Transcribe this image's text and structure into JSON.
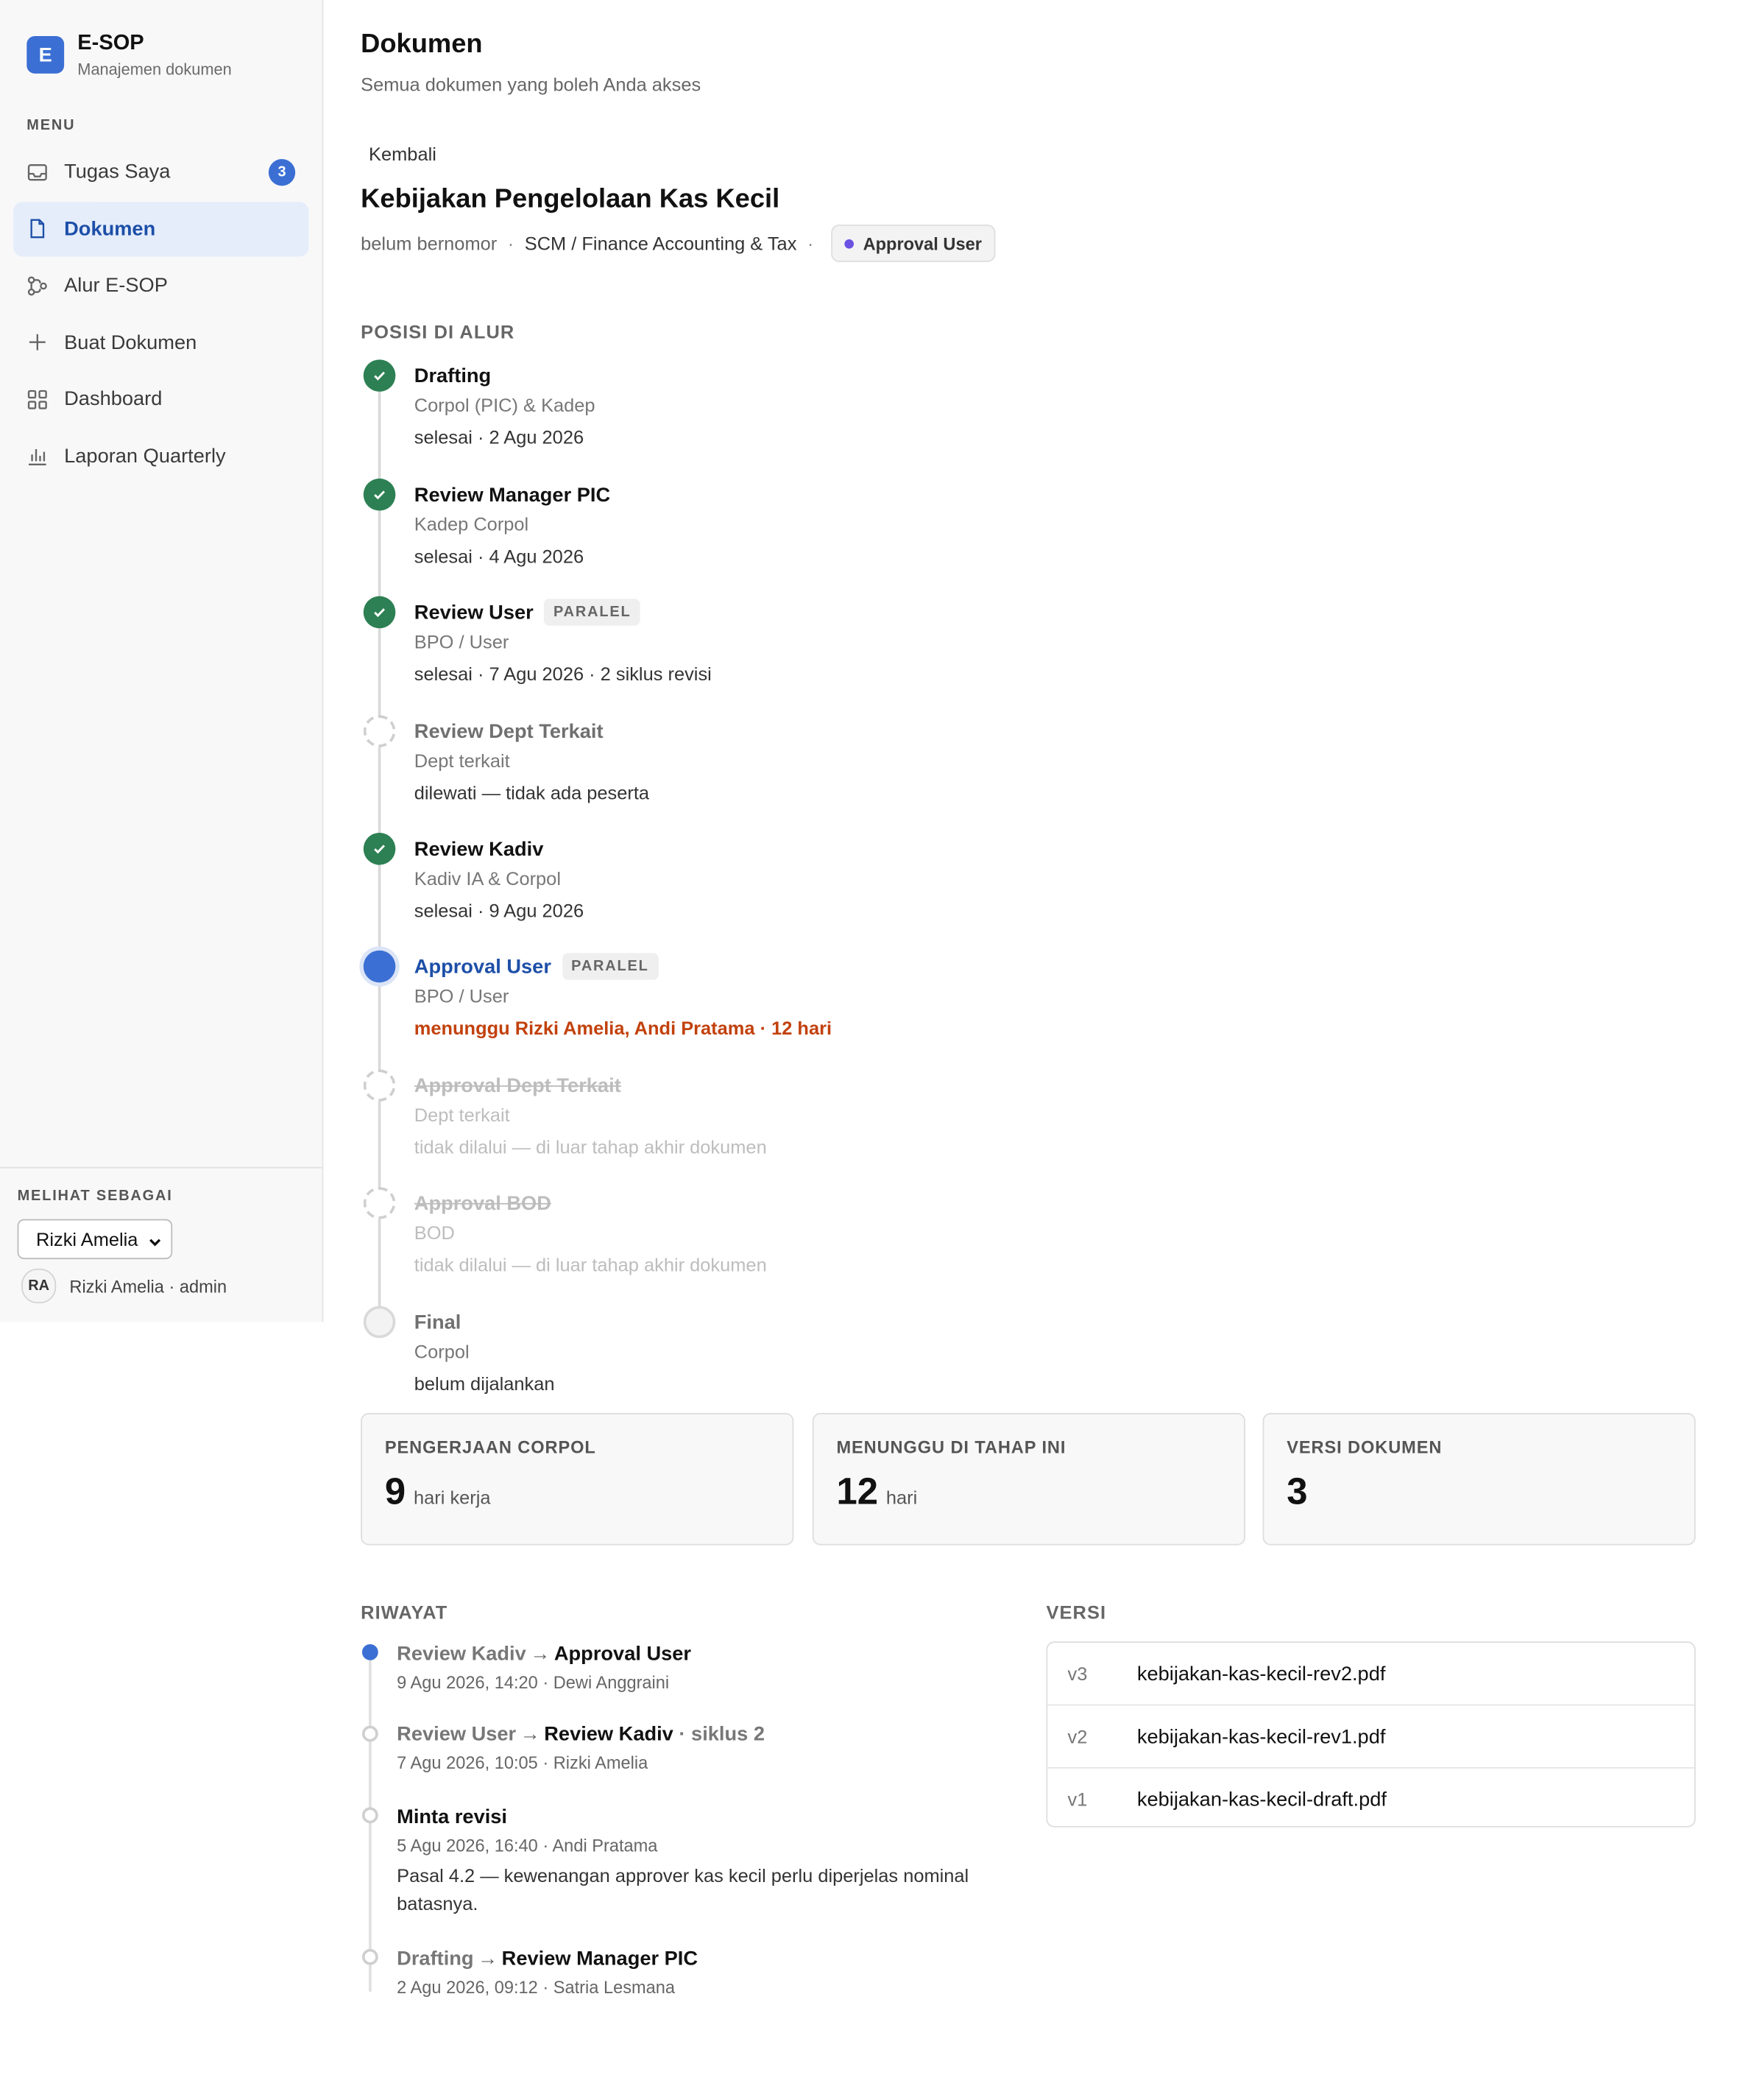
{
  "app": {
    "logo_letter": "E",
    "name": "E-SOP",
    "subtitle": "Manajemen dokumen"
  },
  "sidebar": {
    "menu_label": "MENU",
    "items": [
      {
        "label": "Tugas Saya",
        "icon": "inbox-icon",
        "badge": "3"
      },
      {
        "label": "Dokumen",
        "icon": "document-icon",
        "active": true
      },
      {
        "label": "Alur E-SOP",
        "icon": "workflow-icon"
      },
      {
        "label": "Buat Dokumen",
        "icon": "plus-icon"
      },
      {
        "label": "Dashboard",
        "icon": "grid-icon"
      },
      {
        "label": "Laporan Quarterly",
        "icon": "bar-chart-icon"
      }
    ],
    "view_as_label": "MELIHAT SEBAGAI",
    "view_as_selected": "Rizki Amelia",
    "user_initials": "RA",
    "user_text": "Rizki Amelia · admin"
  },
  "header": {
    "title": "Dokumen",
    "subtitle": "Semua dokumen yang boleh Anda akses"
  },
  "doc": {
    "back_label": "Kembali",
    "title": "Kebijakan Pengelolaan Kas Kecil",
    "number": "belum bernomor",
    "separator": "·",
    "department": "SCM / Finance Accounting & Tax",
    "stage_badge": "Approval User",
    "stage_dot_color": "#6b52e3"
  },
  "workflow": {
    "label": "POSISI DI ALUR",
    "steps": [
      {
        "title": "Drafting",
        "role": "Corpol (PIC) & Kadep",
        "status": "selesai · 2 Agu 2026",
        "state": "done"
      },
      {
        "title": "Review Manager PIC",
        "role": "Kadep Corpol",
        "status": "selesai · 4 Agu 2026",
        "state": "done"
      },
      {
        "title": "Review User",
        "tag": "PARALEL",
        "role": "BPO / User",
        "status": "selesai · 7 Agu 2026 · 2 siklus revisi",
        "state": "done"
      },
      {
        "title": "Review Dept Terkait",
        "role": "Dept terkait",
        "status": "dilewati — tidak ada peserta",
        "state": "skipped"
      },
      {
        "title": "Review Kadiv",
        "role": "Kadiv IA & Corpol",
        "status": "selesai · 9 Agu 2026",
        "state": "done"
      },
      {
        "title": "Approval User",
        "tag": "PARALEL",
        "role": "BPO / User",
        "status": "menunggu Rizki Amelia, Andi Pratama · 12 hari",
        "state": "current"
      },
      {
        "title": "Approval Dept Terkait",
        "role": "Dept terkait",
        "status": "tidak dilalui — di luar tahap akhir dokumen",
        "state": "excluded"
      },
      {
        "title": "Approval BOD",
        "role": "BOD",
        "status": "tidak dilalui — di luar tahap akhir dokumen",
        "state": "excluded"
      },
      {
        "title": "Final",
        "role": "Corpol",
        "status": "belum dijalankan",
        "state": "pending"
      }
    ]
  },
  "stats": [
    {
      "label": "PENGERJAAN CORPOL",
      "value": "9",
      "unit": "hari kerja"
    },
    {
      "label": "MENUNGGU DI TAHAP INI",
      "value": "12",
      "unit": "hari"
    },
    {
      "label": "VERSI DOKUMEN",
      "value": "3",
      "unit": ""
    }
  ],
  "history": {
    "label": "RIWAYAT",
    "arrow": "→",
    "entries": [
      {
        "from": "Review Kadiv",
        "to": "Approval User",
        "extra": "",
        "meta": "9 Agu 2026, 14:20 · Dewi Anggraini"
      },
      {
        "from": "Review User",
        "to": "Review Kadiv",
        "extra": "· siklus 2",
        "meta": "7 Agu 2026, 10:05 · Rizki Amelia"
      },
      {
        "title": "Minta revisi",
        "meta": "5 Agu 2026, 16:40 · Andi Pratama",
        "note": "Pasal 4.2 — kewenangan approver kas kecil perlu diperjelas nominal batasnya."
      },
      {
        "from": "Drafting",
        "to": "Review Manager PIC",
        "extra": "",
        "meta": "2 Agu 2026, 09:12 · Satria Lesmana"
      }
    ]
  },
  "versions": {
    "label": "VERSI",
    "items": [
      {
        "tag": "v3",
        "file": "kebijakan-kas-kecil-rev2.pdf"
      },
      {
        "tag": "v2",
        "file": "kebijakan-kas-kecil-rev1.pdf"
      },
      {
        "tag": "v1",
        "file": "kebijakan-kas-kecil-draft.pdf"
      }
    ]
  }
}
